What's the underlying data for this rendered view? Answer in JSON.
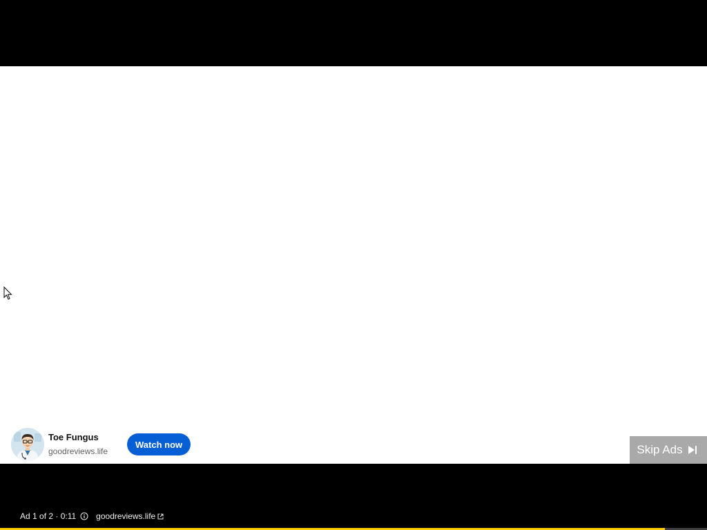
{
  "ad_card": {
    "title": "Toe Fungus",
    "domain": "goodreviews.life",
    "cta_label": "Watch now",
    "avatar_icon": "doctor-avatar-icon"
  },
  "skip": {
    "label": "Skip Ads",
    "icon": "skip-next-icon"
  },
  "ad_info": {
    "counter": "Ad 1 of 2 · 0:11",
    "info_icon": "info-icon",
    "link_label": "goodreviews.life",
    "link_icon": "external-link-icon"
  },
  "progress": {
    "fraction": 0.94,
    "color": "#ffcc00"
  },
  "colors": {
    "cta": "#065fd4",
    "frame": "#ffffff",
    "letterbox": "#000000"
  }
}
